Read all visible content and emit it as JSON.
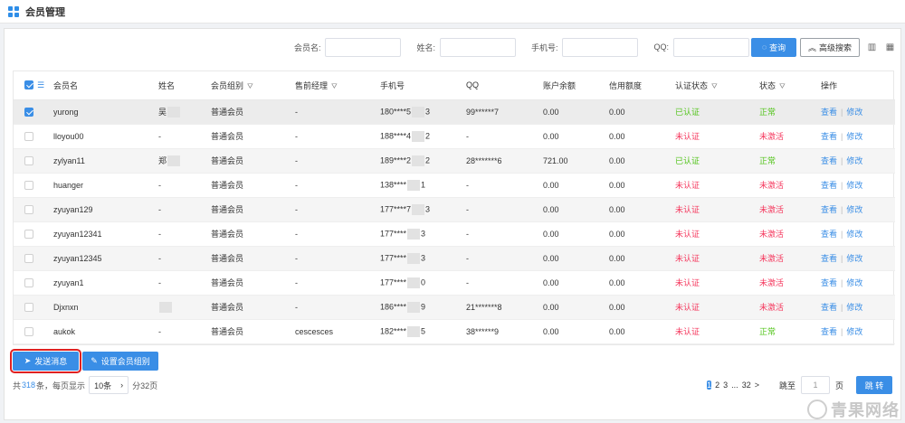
{
  "header": {
    "title": "会员管理"
  },
  "search": {
    "fields": [
      {
        "label": "会员名:",
        "value": "",
        "placeholder": ""
      },
      {
        "label": "姓名:",
        "value": "",
        "placeholder": ""
      },
      {
        "label": "手机号:",
        "value": "",
        "placeholder": ""
      },
      {
        "label": "QQ:",
        "value": "",
        "placeholder": ""
      }
    ],
    "query_label": "查询",
    "advanced_label": "高级搜索"
  },
  "table": {
    "columns": [
      "会员名",
      "姓名",
      "会员组别",
      "售前经理",
      "手机号",
      "QQ",
      "账户余额",
      "信用额度",
      "认证状态",
      "状态",
      "操作"
    ],
    "rows": [
      {
        "checked": true,
        "username": "yurong",
        "name": "吴",
        "group": "普通会员",
        "manager": "-",
        "phone_a": "180****5",
        "phone_b": "3",
        "qq": "99******7",
        "balance": "0.00",
        "credit": "0.00",
        "auth": "已认证",
        "auth_ok": true,
        "status": "正常",
        "status_ok": true
      },
      {
        "checked": false,
        "username": "lloyou00",
        "name": "-",
        "group": "普通会员",
        "manager": "-",
        "phone_a": "188****4",
        "phone_b": "2",
        "qq": "-",
        "balance": "0.00",
        "credit": "0.00",
        "auth": "未认证",
        "auth_ok": false,
        "status": "未激活",
        "status_ok": false
      },
      {
        "checked": false,
        "username": "zylyan11",
        "name": "郑",
        "group": "普通会员",
        "manager": "-",
        "phone_a": "189****2",
        "phone_b": "2",
        "qq": "28*******6",
        "balance": "721.00",
        "credit": "0.00",
        "auth": "已认证",
        "auth_ok": true,
        "status": "正常",
        "status_ok": true
      },
      {
        "checked": false,
        "username": "huanger",
        "name": "-",
        "group": "普通会员",
        "manager": "-",
        "phone_a": "138****",
        "phone_b": "1",
        "qq": "-",
        "balance": "0.00",
        "credit": "0.00",
        "auth": "未认证",
        "auth_ok": false,
        "status": "未激活",
        "status_ok": false
      },
      {
        "checked": false,
        "username": "zyuyan129",
        "name": "-",
        "group": "普通会员",
        "manager": "-",
        "phone_a": "177****7",
        "phone_b": "3",
        "qq": "-",
        "balance": "0.00",
        "credit": "0.00",
        "auth": "未认证",
        "auth_ok": false,
        "status": "未激活",
        "status_ok": false
      },
      {
        "checked": false,
        "username": "zyuyan12341",
        "name": "-",
        "group": "普通会员",
        "manager": "-",
        "phone_a": "177****",
        "phone_b": "3",
        "qq": "-",
        "balance": "0.00",
        "credit": "0.00",
        "auth": "未认证",
        "auth_ok": false,
        "status": "未激活",
        "status_ok": false
      },
      {
        "checked": false,
        "username": "zyuyan12345",
        "name": "-",
        "group": "普通会员",
        "manager": "-",
        "phone_a": "177****",
        "phone_b": "3",
        "qq": "-",
        "balance": "0.00",
        "credit": "0.00",
        "auth": "未认证",
        "auth_ok": false,
        "status": "未激活",
        "status_ok": false
      },
      {
        "checked": false,
        "username": "zyuyan1",
        "name": "-",
        "group": "普通会员",
        "manager": "-",
        "phone_a": "177****",
        "phone_b": "0",
        "qq": "-",
        "balance": "0.00",
        "credit": "0.00",
        "auth": "未认证",
        "auth_ok": false,
        "status": "未激活",
        "status_ok": false
      },
      {
        "checked": false,
        "username": "Djxnxn",
        "name": "",
        "group": "普通会员",
        "manager": "-",
        "phone_a": "186****",
        "phone_b": "9",
        "qq": "21*******8",
        "balance": "0.00",
        "credit": "0.00",
        "auth": "未认证",
        "auth_ok": false,
        "status": "未激活",
        "status_ok": false
      },
      {
        "checked": false,
        "username": "aukok",
        "name": "-",
        "group": "普通会员",
        "manager": "cescesces",
        "phone_a": "182****",
        "phone_b": "5",
        "qq": "38******9",
        "balance": "0.00",
        "credit": "0.00",
        "auth": "未认证",
        "auth_ok": false,
        "status": "正常",
        "status_ok": true
      }
    ],
    "actions": {
      "view": "查看",
      "edit": "修改"
    }
  },
  "bulk_actions": {
    "send_message": "发送消息",
    "set_group": "设置会员组别"
  },
  "footer": {
    "total_prefix": "共",
    "total": "318",
    "total_suffix": "条，每页显示",
    "page_size": "10条",
    "pages_text": "分32页"
  },
  "pagination": {
    "pages": [
      "1",
      "2",
      "3",
      "...",
      "32",
      ">"
    ],
    "active": "1",
    "jump_label": "跳至",
    "jump_value": "1",
    "page_unit": "页",
    "go_label": "跳 转"
  },
  "watermark": {
    "text": "青果网络"
  },
  "colors": {
    "accent": "#3a8ee6",
    "success": "#52c41a",
    "danger": "#f5365c"
  }
}
